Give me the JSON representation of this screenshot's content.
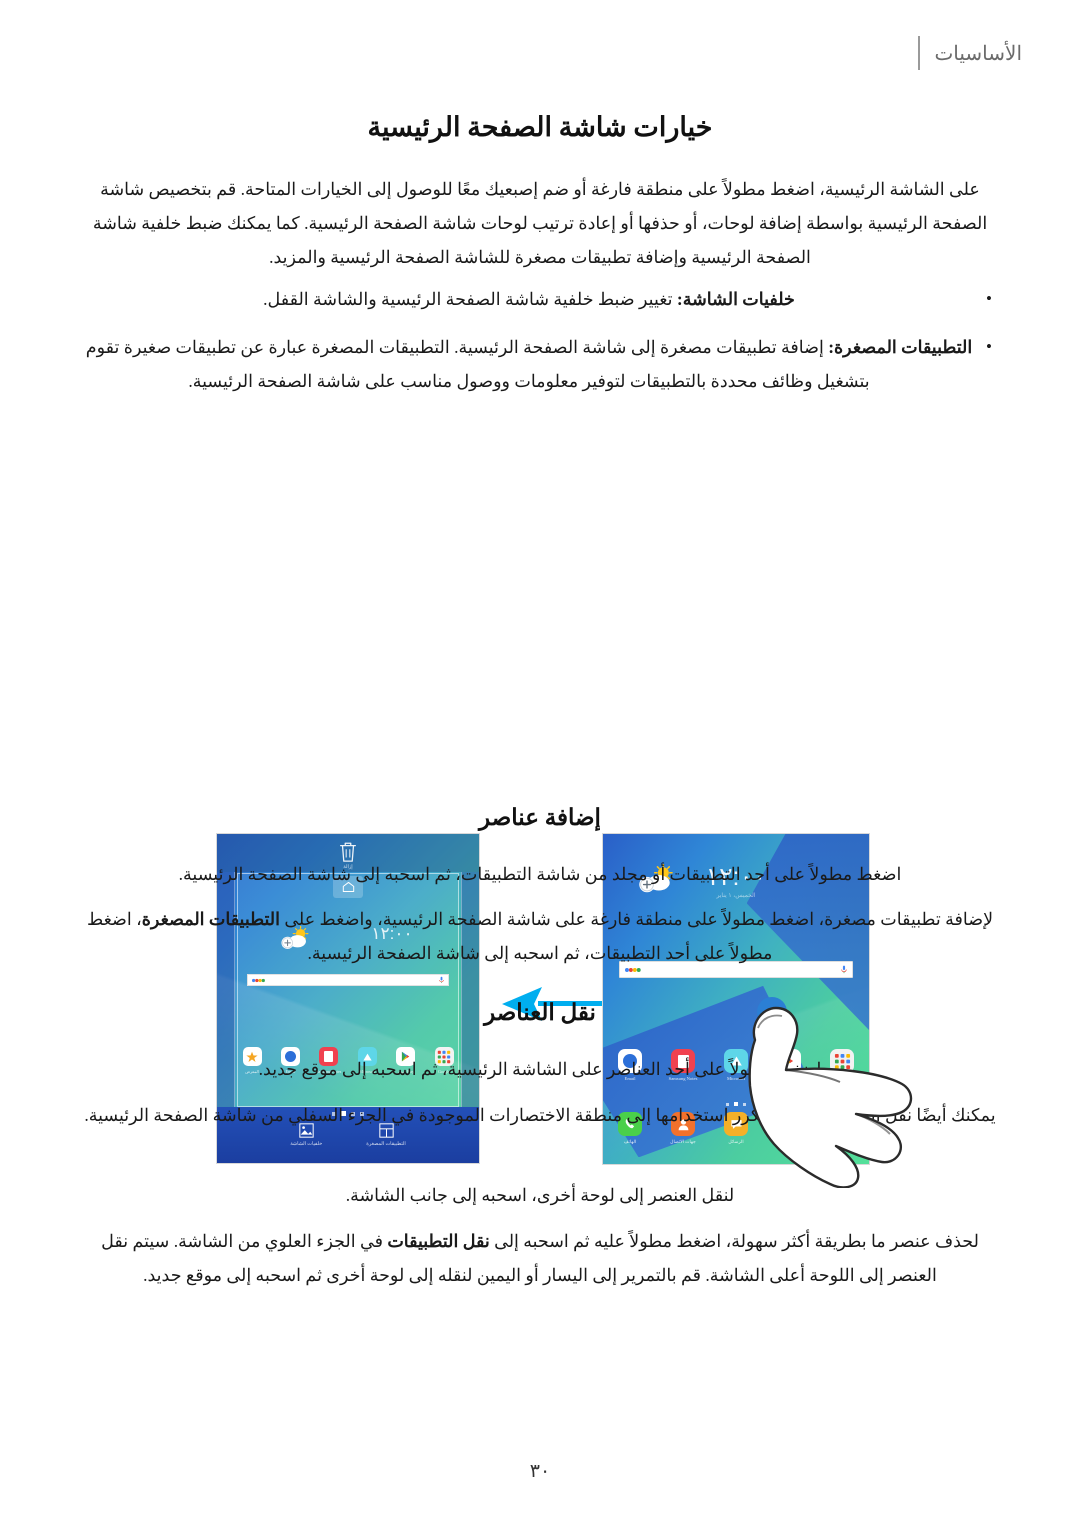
{
  "header": {
    "title": "الأساسيات"
  },
  "sections": {
    "home_screen_options": {
      "title": "خيارات شاشة الصفحة الرئيسية",
      "intro": "على الشاشة الرئيسية، اضغط مطولاً على منطقة فارغة أو ضم إصبعيك معًا للوصول إلى الخيارات المتاحة. قم بتخصيص شاشة الصفحة الرئيسية بواسطة إضافة لوحات، أو حذفها أو إعادة ترتيب لوحات شاشة الصفحة الرئيسية. كما يمكنك ضبط خلفية شاشة الصفحة الرئيسية وإضافة تطبيقات مصغرة للشاشة الصفحة الرئيسية والمزيد.",
      "bullets": [
        {
          "term": "خلفيات الشاشة:",
          "text": " تغيير ضبط خلفية شاشة الصفحة الرئيسية والشاشة القفل."
        },
        {
          "term": "التطبيقات المصغرة:",
          "text": " إضافة تطبيقات مصغرة إلى شاشة الصفحة الرئيسية. التطبيقات المصغرة عبارة عن تطبيقات صغيرة تقوم بتشغيل وظائف محددة بالتطبيقات لتوفير معلومات ووصول مناسب على شاشة الصفحة الرئيسية."
        }
      ]
    },
    "adding_items": {
      "title": "إضافة عناصر",
      "paragraph_1": "اضغط مطولاً على أحد التطبيقات أو مجلد من شاشة التطبيقات، ثم اسحبه إلى شاشة الصفحة الرئيسية.",
      "paragraph_2_part1": "لإضافة تطبيقات مصغرة، اضغط مطولاً على منطقة فارغة على شاشة الصفحة الرئيسية، واضغط على ",
      "paragraph_2_bold1": "التطبيقات المصغرة",
      "paragraph_2_part2": "، اضغط مطولاً على أحد التطبيقات، ثم اسحبه إلى شاشة الصفحة الرئيسية."
    },
    "moving_items": {
      "title": "نقل العناصر",
      "paragraph_1": "اضغط مطولاً على أحد العناصر على الشاشة الرئيسية، ثم اسحبه إلى موقع جديد.",
      "paragraph_2": "يمكنك أيضًا نقل التطبيقات التي يتكرر استخدامها إلى منطقة الاختصارات الموجودة في الجزء السفلي من شاشة الصفحة الرئيسية.",
      "paragraph_3": "لنقل العنصر إلى لوحة أخرى، اسحبه إلى جانب الشاشة.",
      "paragraph_4_part1": "لحذف عنصر ما بطريقة أكثر سهولة، اضغط مطولاً عليه ثم اسحبه إلى ",
      "paragraph_4_bold1": "نقل التطبيقات",
      "paragraph_4_part2": " في الجزء العلوي من الشاشة. سيتم نقل العنصر إلى اللوحة أعلى الشاشة. قم بالتمرير إلى اليسار أو اليمين لنقله إلى لوحة أخرى ثم اسحبه إلى موقع جديد."
    }
  },
  "figure": {
    "arrow_color": "#00AEEF",
    "left_screenshot": {
      "label": "home-screen-edit-mode",
      "trash_label": "إزالة",
      "actions": [
        {
          "icon": "widgets-icon",
          "label": "التطبيقات المصغرة"
        },
        {
          "icon": "wallpaper-icon",
          "label": "خلفيات الشاشة"
        }
      ],
      "clock": "١٢:٠٠",
      "apps": [
        {
          "name": "Google",
          "color": "#f5f5f5"
        },
        {
          "name": "Play ستور",
          "color": "#ffffff"
        },
        {
          "name": "Microsoft",
          "color": "#5ed6e8"
        },
        {
          "name": "Samsung Notes",
          "color": "#f0414f"
        },
        {
          "name": "Email",
          "color": "#ffffff"
        },
        {
          "name": "المعرض",
          "color": "#ffffff"
        }
      ]
    },
    "right_screenshot": {
      "label": "home-screen-long-press",
      "clock": "١٢:٠٠",
      "clock_sub": "الخميس، ١ يناير",
      "apps_row_1": [
        {
          "name": "Google",
          "color": "#f2f2f2"
        },
        {
          "name": "Play ستور",
          "color": "#ffffff"
        },
        {
          "name": "Microsoft",
          "color": "#5ed6e8"
        },
        {
          "name": "Samsung Notes",
          "color": "#f0414f"
        },
        {
          "name": "Email",
          "color": "#ffffff"
        }
      ],
      "apps_dock": [
        {
          "name": "التطبيقات",
          "color": "#f2f2f2"
        },
        {
          "name": "الإنترنت",
          "color": "#9b7ce8"
        },
        {
          "name": "الرسائل",
          "color": "#f5b027"
        },
        {
          "name": "جهات الاتصال",
          "color": "#f2712c"
        },
        {
          "name": "الهاتف",
          "color": "#4ad04a"
        }
      ]
    }
  },
  "page_number": "٣٠"
}
